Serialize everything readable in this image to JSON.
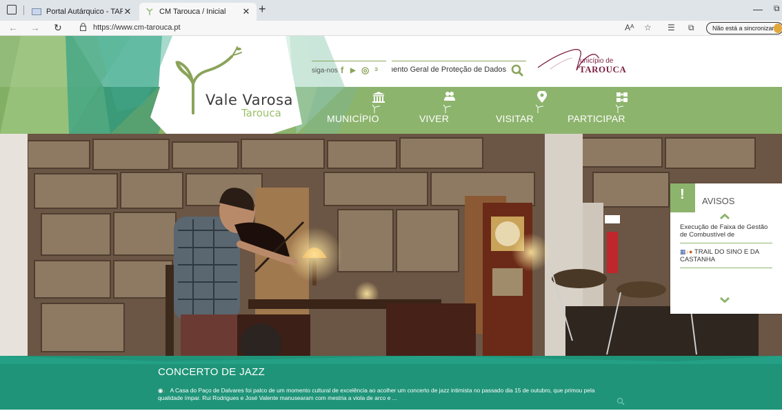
{
  "browser": {
    "tabs": [
      {
        "title": "Portal Autárquico - TAROUCA",
        "close": "✕"
      },
      {
        "title": "CM Tarouca / Inicial",
        "close": "✕"
      }
    ],
    "new_tab": "+",
    "url": "https://www.cm-tarouca.pt",
    "sync_label": "Não está a sincronizar"
  },
  "header": {
    "logo_name": "Vale Varosa",
    "logo_sub": "Tarouca",
    "follow_label": "siga-nos",
    "search": {
      "value": "Regulamento Geral de Proteção de Dados"
    },
    "municipality": {
      "line1": "unicípio de",
      "line2": "TAROUCA"
    }
  },
  "menu": [
    {
      "label": "MUNICÍPIO",
      "icon": "building-icon"
    },
    {
      "label": "VIVER",
      "icon": "people-icon"
    },
    {
      "label": "VISITAR",
      "icon": "map-pin-icon"
    },
    {
      "label": "PARTICIPAR",
      "icon": "puzzle-icon"
    }
  ],
  "avisos": {
    "title": "AVISOS",
    "items": [
      {
        "text": "Execução de Faixa de Gestão de Combustível de"
      },
      {
        "text": "TRAIL DO SINO E DA CASTANHA"
      }
    ]
  },
  "feature": {
    "title": "CONCERTO DE JAZZ",
    "text": "A Casa do Paço de Dalvares foi palco de um momento cultural de excelência ao acolher um concerto de jazz intimista no passado dia 15 de outubro, que primou pela qualidade ímpar. Rui Rodrigues e José Valente manusearam com mestria a viola de arco e ..."
  },
  "colors": {
    "accent_green": "#8db46d",
    "band_teal": "#1f9478",
    "municipality_wine": "#7b1d3f"
  }
}
